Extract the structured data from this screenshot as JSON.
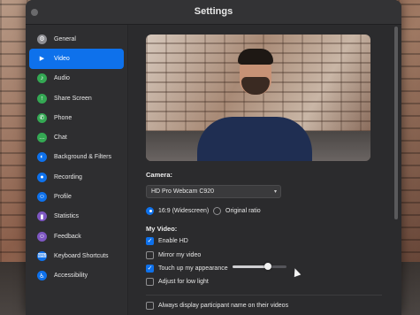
{
  "window": {
    "title": "Settings"
  },
  "sidebar": {
    "items": [
      {
        "label": "General",
        "icon": "gear-icon",
        "color": "#8e8e93"
      },
      {
        "label": "Video",
        "icon": "video-camera-icon",
        "color": "#0e71eb",
        "active": true
      },
      {
        "label": "Audio",
        "icon": "headphones-icon",
        "color": "#34a853"
      },
      {
        "label": "Share Screen",
        "icon": "share-screen-icon",
        "color": "#34a853"
      },
      {
        "label": "Phone",
        "icon": "phone-icon",
        "color": "#34a853"
      },
      {
        "label": "Chat",
        "icon": "chat-icon",
        "color": "#34a853"
      },
      {
        "label": "Background & Filters",
        "icon": "person-background-icon",
        "color": "#0e71eb"
      },
      {
        "label": "Recording",
        "icon": "record-icon",
        "color": "#0e71eb"
      },
      {
        "label": "Profile",
        "icon": "profile-icon",
        "color": "#0e71eb"
      },
      {
        "label": "Statistics",
        "icon": "statistics-icon",
        "color": "#7e57c2"
      },
      {
        "label": "Feedback",
        "icon": "feedback-icon",
        "color": "#7e57c2"
      },
      {
        "label": "Keyboard Shortcuts",
        "icon": "keyboard-icon",
        "color": "#0e71eb"
      },
      {
        "label": "Accessibility",
        "icon": "accessibility-icon",
        "color": "#0e71eb"
      }
    ]
  },
  "video": {
    "camera_label": "Camera:",
    "camera_value": "HD Pro Webcam C920",
    "aspect_widescreen": "16:9 (Widescreen)",
    "aspect_original": "Original ratio",
    "my_video_label": "My Video:",
    "enable_hd": "Enable HD",
    "mirror_video": "Mirror my video",
    "touch_up": "Touch up my appearance",
    "touch_up_level": 0.65,
    "adjust_low_light": "Adjust for low light",
    "always_display_names": "Always display participant name on their videos"
  },
  "colors": {
    "accent": "#0e71eb"
  }
}
